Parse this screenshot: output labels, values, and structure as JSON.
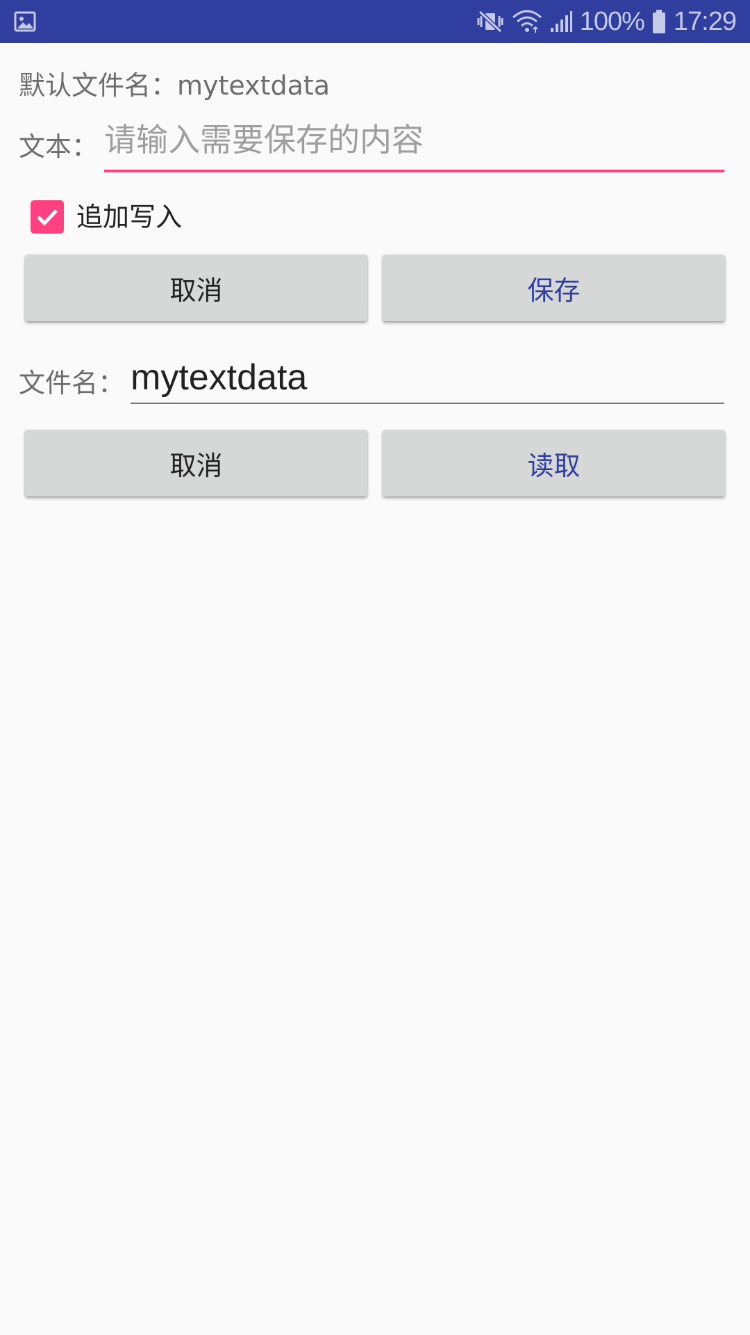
{
  "status_bar": {
    "battery": "100%",
    "time": "17:29",
    "icons": [
      "gallery-icon",
      "mute-vibrate-icon",
      "wifi-icon",
      "signal-icon",
      "battery-icon"
    ]
  },
  "main": {
    "default_filename_label": "默认文件名：mytextdata",
    "text_label": "文本：",
    "text_placeholder": "请输入需要保存的内容",
    "text_value": "",
    "append_checkbox": {
      "label": "追加写入",
      "checked": true
    },
    "save_row": {
      "cancel_label": "取消",
      "save_label": "保存"
    },
    "filename_label": "文件名：",
    "filename_value": "mytextdata",
    "read_row": {
      "cancel_label": "取消",
      "read_label": "读取"
    }
  },
  "colors": {
    "status_bar_bg": "#303f9f",
    "accent": "#ff4081",
    "primary_text": "#303f9f",
    "background": "#fafafa",
    "button_bg": "#d6d7d7"
  }
}
